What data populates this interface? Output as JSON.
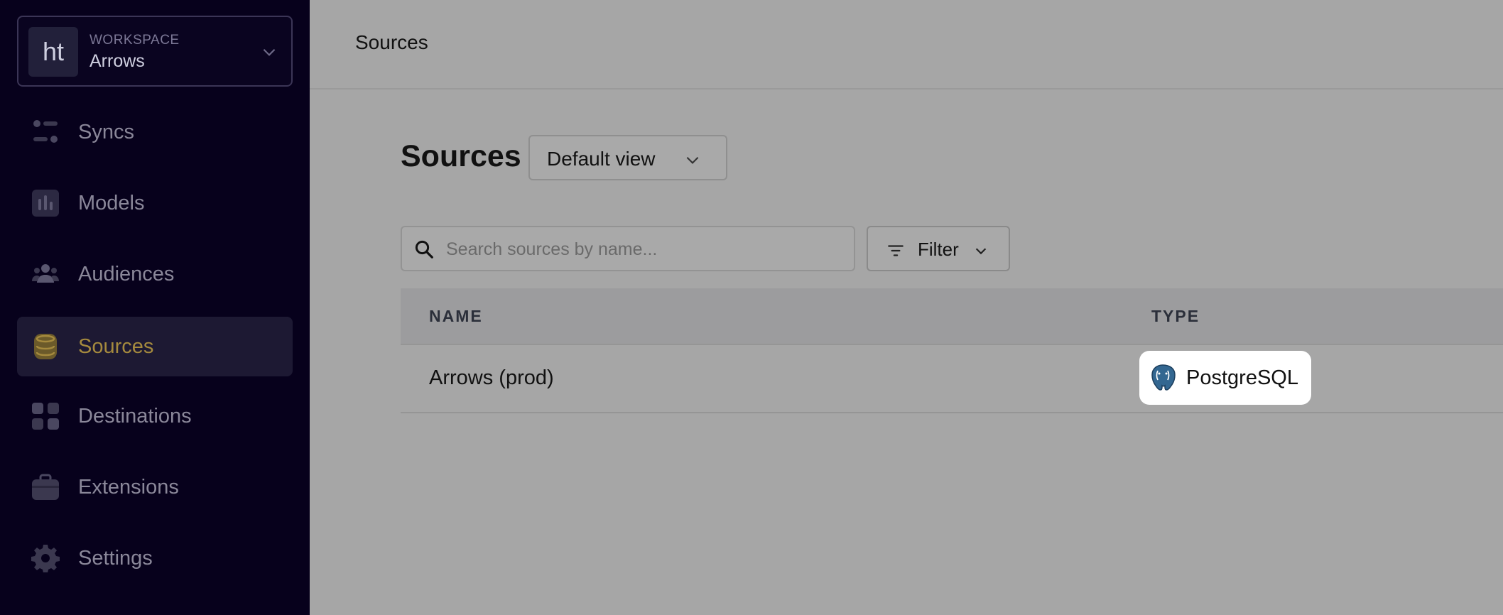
{
  "workspace": {
    "avatar": "ht",
    "label": "WORKSPACE",
    "name": "Arrows"
  },
  "sidebar": {
    "items": [
      {
        "label": "Syncs",
        "icon": "syncs-icon"
      },
      {
        "label": "Models",
        "icon": "models-icon"
      },
      {
        "label": "Audiences",
        "icon": "audiences-icon"
      },
      {
        "label": "Sources",
        "icon": "database-icon",
        "active": true
      },
      {
        "label": "Destinations",
        "icon": "grid-icon"
      },
      {
        "label": "Extensions",
        "icon": "briefcase-icon"
      },
      {
        "label": "Settings",
        "icon": "gear-icon"
      }
    ]
  },
  "header": {
    "title": "Sources"
  },
  "main": {
    "title": "Sources",
    "view_select": "Default view",
    "search_placeholder": "Search sources by name...",
    "filter_label": "Filter",
    "table": {
      "columns": [
        "NAME",
        "TYPE"
      ],
      "rows": [
        {
          "name": "Arrows (prod)",
          "type": "PostgreSQL"
        }
      ]
    }
  },
  "colors": {
    "sidebar_bg": "#07011c",
    "active_accent": "#a58a3e",
    "overlay_bg": "#a6a6a6"
  }
}
